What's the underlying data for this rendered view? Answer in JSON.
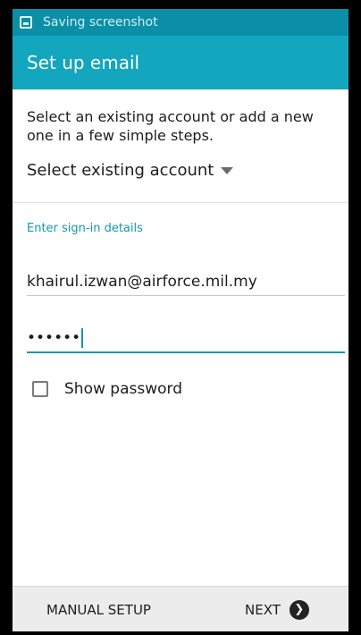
{
  "status_bar": {
    "notification_icon": "screenshot-icon",
    "notification_text": "Saving screenshot"
  },
  "action_bar": {
    "title": "Set up email"
  },
  "main": {
    "intro_text": "Select an existing account or add a new one in a few simple steps.",
    "select_existing_label": "Select existing account",
    "section_header": "Enter sign-in details",
    "email_value": "khairul.izwan@airforce.mil.my",
    "password_value": "••••••",
    "show_password_label": "Show password",
    "show_password_checked": false
  },
  "bottom_bar": {
    "manual_setup_label": "MANUAL SETUP",
    "next_label": "NEXT",
    "next_icon": "chevron-right-circle-icon"
  },
  "colors": {
    "status_bar": "#0b8fa6",
    "action_bar": "#12a6bf",
    "accent": "#1497ad"
  }
}
